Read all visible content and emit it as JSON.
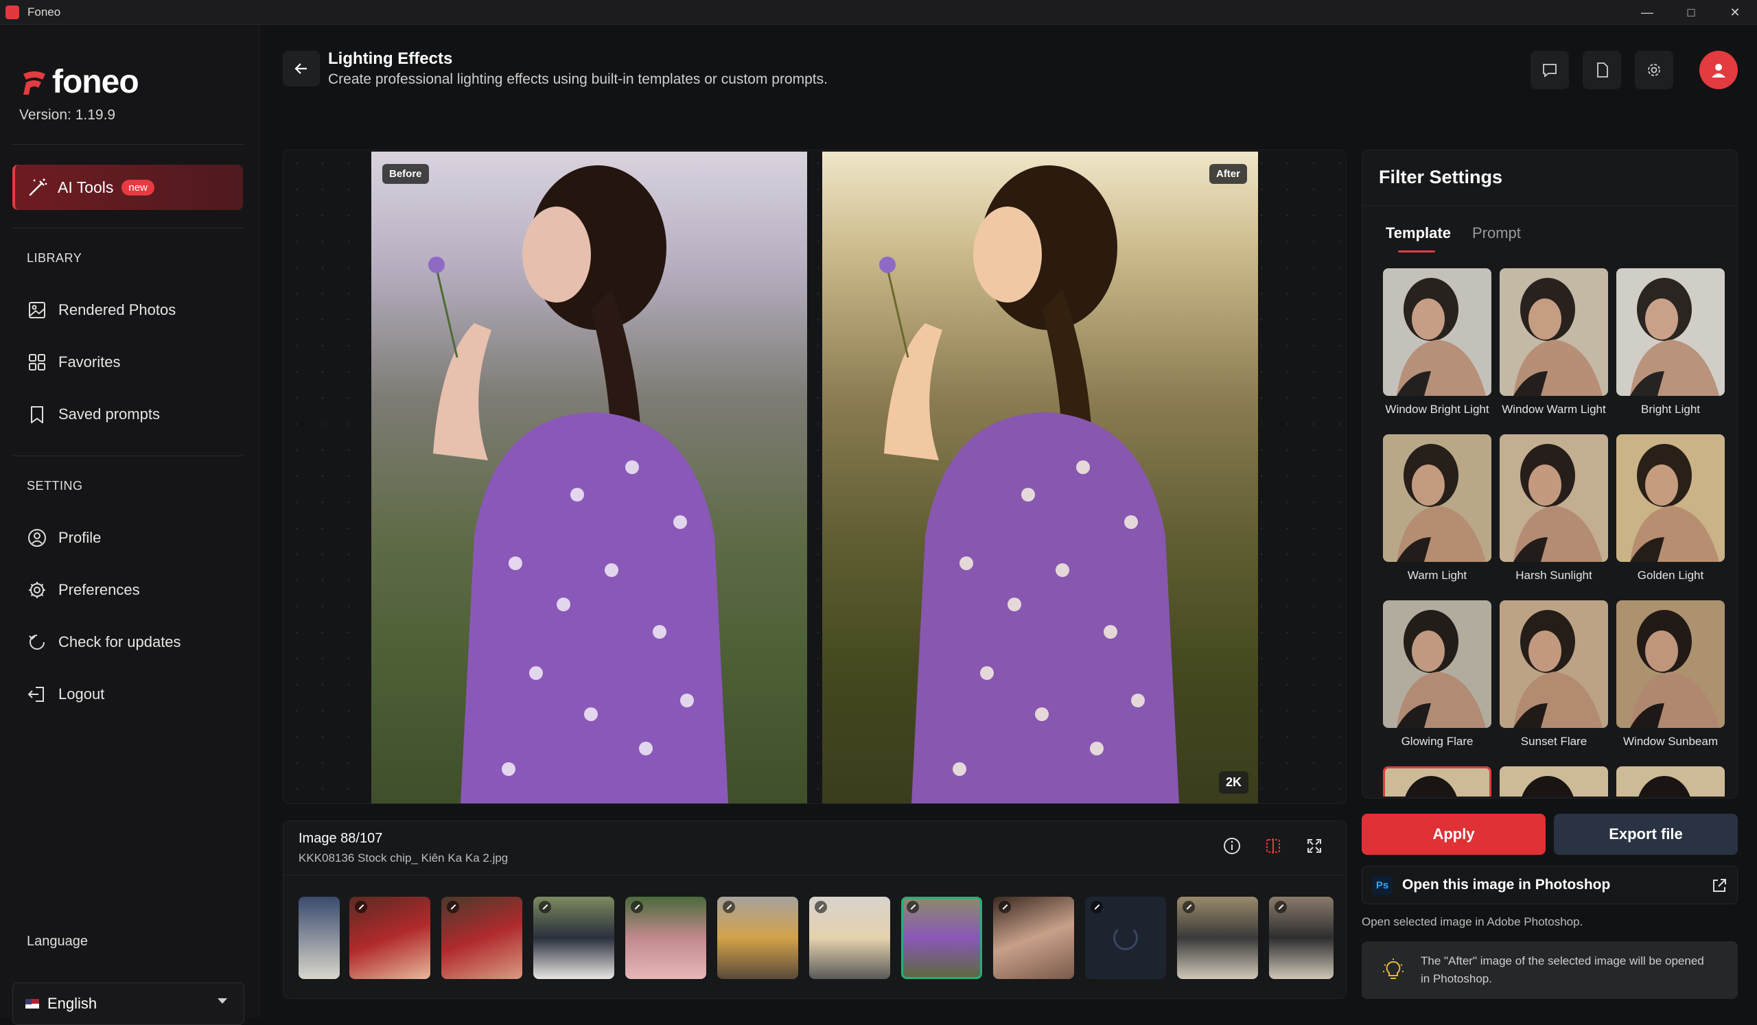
{
  "window": {
    "title": "Foneo"
  },
  "sidebar": {
    "brand": "foneo",
    "version": "Version: 1.19.9",
    "ai_tools": {
      "label": "AI Tools",
      "badge": "new"
    },
    "library_heading": "LIBRARY",
    "library_items": [
      {
        "label": "Rendered Photos"
      },
      {
        "label": "Favorites"
      },
      {
        "label": "Saved prompts"
      }
    ],
    "setting_heading": "SETTING",
    "setting_items": [
      {
        "label": "Profile"
      },
      {
        "label": "Preferences"
      },
      {
        "label": "Check for updates"
      },
      {
        "label": "Logout"
      }
    ],
    "language_heading": "Language",
    "language_value": "English"
  },
  "header": {
    "title": "Lighting Effects",
    "subtitle": "Create professional lighting effects using built-in templates or custom prompts."
  },
  "preview": {
    "before_label": "Before",
    "after_label": "After",
    "resolution": "2K"
  },
  "strip": {
    "count": "Image 88/107",
    "filename": "KKK08136 Stock chip_ Kiên Ka Ka 2.jpg"
  },
  "panel": {
    "title": "Filter Settings",
    "tabs": [
      {
        "label": "Template"
      },
      {
        "label": "Prompt"
      }
    ],
    "templates": [
      {
        "label": "Window Bright Light"
      },
      {
        "label": "Window Warm Light"
      },
      {
        "label": "Bright Light"
      },
      {
        "label": "Warm Light"
      },
      {
        "label": "Harsh Sunlight"
      },
      {
        "label": "Golden Light"
      },
      {
        "label": "Glowing Flare"
      },
      {
        "label": "Sunset Flare"
      },
      {
        "label": "Window Sunbeam"
      }
    ]
  },
  "actions": {
    "apply": "Apply",
    "export": "Export file",
    "photoshop_badge": "Ps",
    "photoshop": "Open this image in Photoshop",
    "photoshop_desc": "Open selected image in Adobe Photoshop.",
    "note": "The \"After\" image of the selected image will be opened in Photoshop."
  },
  "colors": {
    "accent": "#e33b3f",
    "selected_thumb": "#22b07a",
    "export_button": "#2a3343"
  }
}
